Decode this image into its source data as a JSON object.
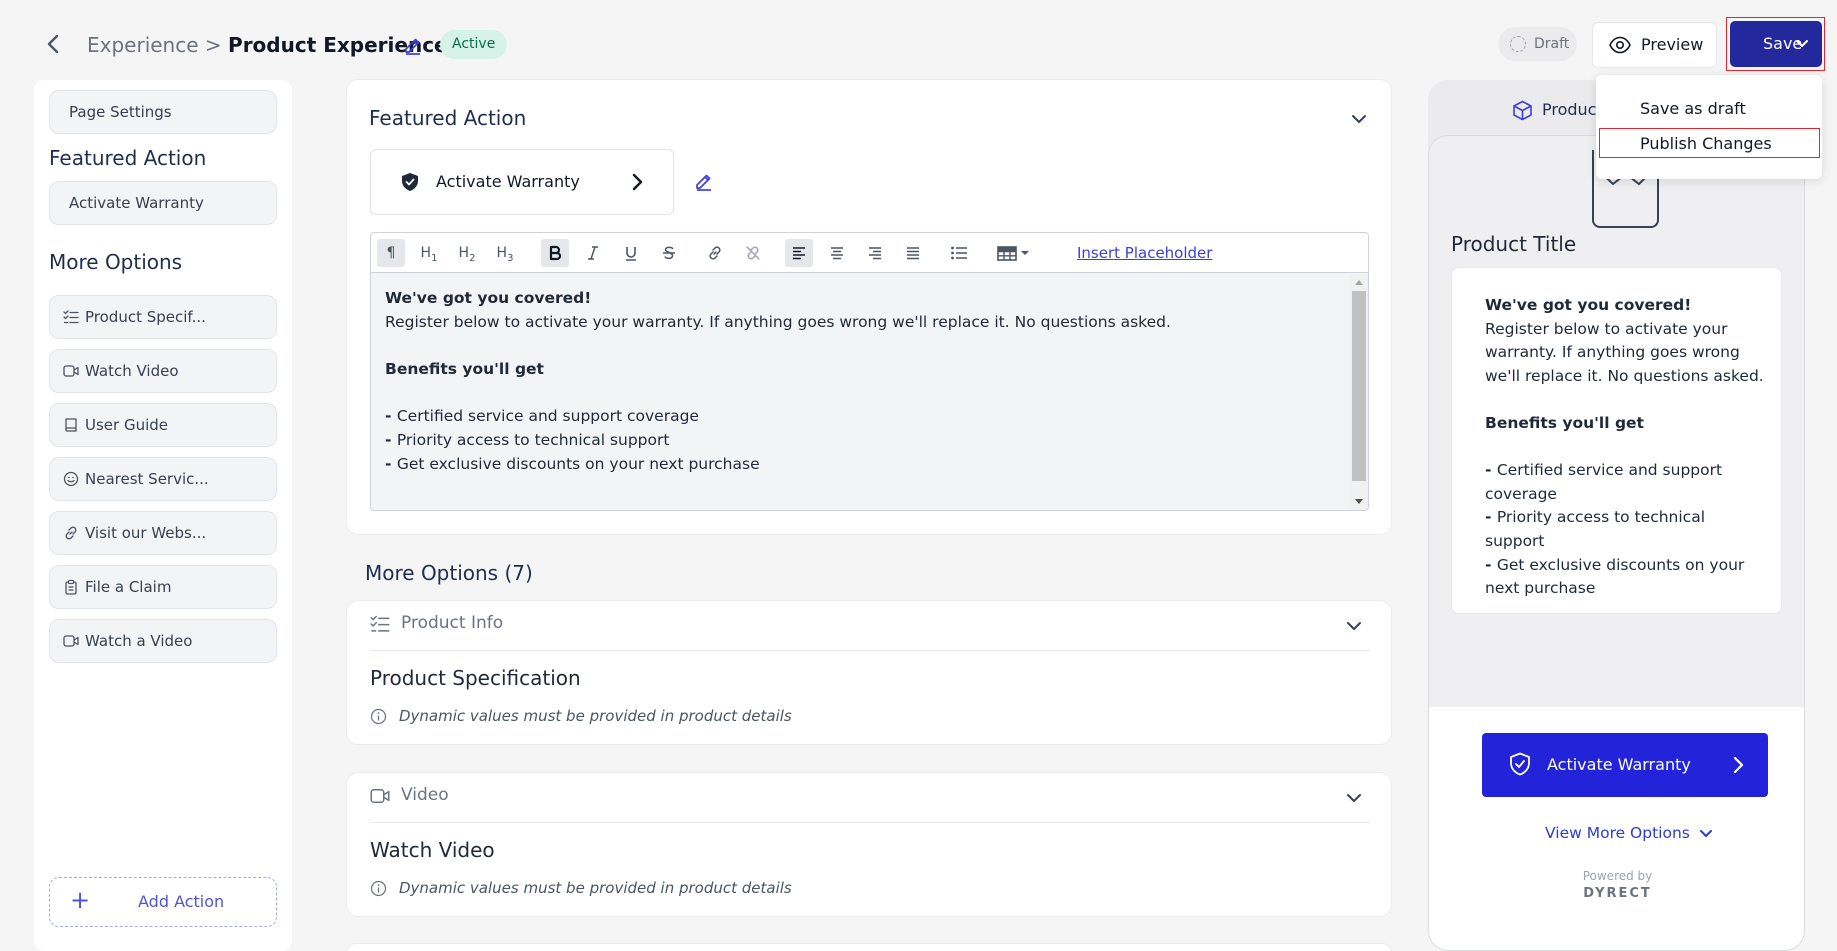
{
  "header": {
    "breadcrumb_parent": "Experience",
    "breadcrumb_separator": ">",
    "breadcrumb_current": "Product Experience",
    "status_badge": "Active",
    "draft_label": "Draft",
    "preview_label": "Preview",
    "save_label": "Save",
    "save_menu": [
      "Save as draft",
      "Publish Changes"
    ]
  },
  "sidebar": {
    "page_settings": "Page Settings",
    "featured_heading": "Featured Action",
    "featured_item": "Activate Warranty",
    "more_heading": "More Options",
    "items": [
      {
        "label": "Product Specif...",
        "icon": "checklist-icon"
      },
      {
        "label": "Watch Video",
        "icon": "video-icon"
      },
      {
        "label": "User Guide",
        "icon": "book-icon"
      },
      {
        "label": "Nearest Servic...",
        "icon": "smile-icon"
      },
      {
        "label": "Visit our Webs...",
        "icon": "link-icon"
      },
      {
        "label": "File a Claim",
        "icon": "clipboard-icon"
      },
      {
        "label": "Watch a Video",
        "icon": "video-icon"
      }
    ],
    "add_action": "Add Action"
  },
  "featured_card": {
    "title": "Featured Action",
    "button_label": "Activate Warranty",
    "toolbar": {
      "paragraph": "¶",
      "h1": "H",
      "h2": "H",
      "h3": "H",
      "insert_placeholder": "Insert Placeholder"
    },
    "content": {
      "heading": "We've got you covered!",
      "line1": "Register below to activate your warranty. If anything goes wrong we'll replace it. No questions asked.",
      "benefits_heading": "Benefits you'll get",
      "benefits": [
        "Certified service and support coverage",
        "Priority access to technical support",
        "Get exclusive discounts on your next purchase"
      ]
    }
  },
  "more_options": {
    "heading": "More Options (7)",
    "cards": [
      {
        "category": "Product Info",
        "title": "Product Specification",
        "note": "Dynamic values must be provided in product details"
      },
      {
        "category": "Video",
        "title": "Watch Video",
        "note": "Dynamic values must be provided in product details"
      }
    ]
  },
  "preview": {
    "tab_label": "Product",
    "product_title": "Product Title",
    "body_heading": "We've got you covered!",
    "body_text": "Register below to activate your warranty. If anything goes wrong we'll replace it. No questions asked.",
    "benefits_heading": "Benefits you'll get",
    "benefits": [
      "Certified service and support coverage",
      "Priority access to technical support",
      "Get exclusive discounts on your next purchase"
    ],
    "cta_label": "Activate Warranty",
    "view_more": "View More Options",
    "powered_by": "Powered by",
    "brand": "DYRECT"
  },
  "colors": {
    "primary": "#23289c",
    "accent_blue": "#2323d9",
    "active_badge_bg": "#d6f3e9",
    "highlight_red": "#e3262f"
  }
}
